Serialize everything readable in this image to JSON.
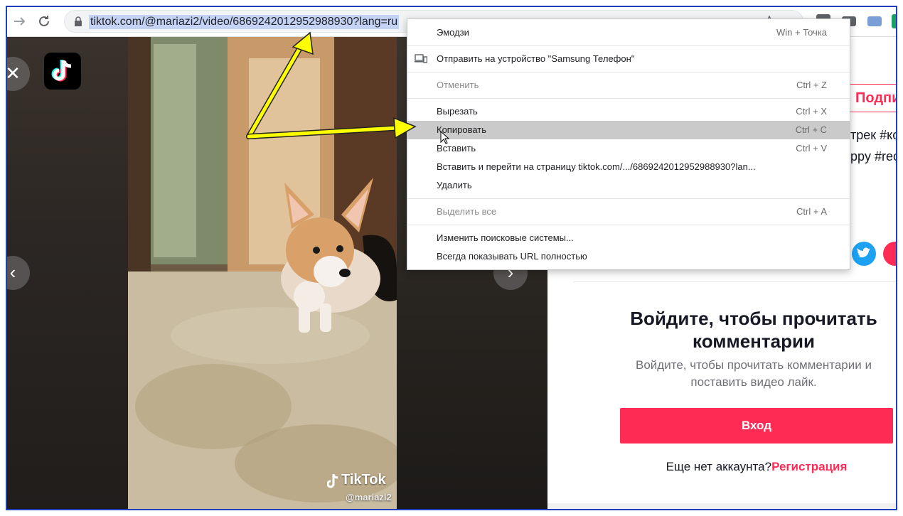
{
  "browser": {
    "url": "tiktok.com/@mariazi2/video/6869242012952988930?lang=ru",
    "back_icon": "arrow-right-icon",
    "reload_icon": "reload-icon"
  },
  "video": {
    "watermark_brand": "TikTok",
    "watermark_user": "@mariazi2",
    "close_icon": "close-icon",
    "prev_icon": "chevron-left-icon",
    "next_icon": "chevron-right-icon"
  },
  "panel": {
    "follow_label": "Подписаться",
    "desc_line1": "трек #ко",
    "desc_line2": "ppy #rec",
    "login_title": "Войдите, чтобы прочитать комментарии",
    "login_subtitle": "Войдите, чтобы прочитать комментарии и поставить видео лайк.",
    "login_button": "Вход",
    "signup_prompt": "Еще нет аккаунта?",
    "signup_link": "Регистрация",
    "accent_color": "#fe2c55"
  },
  "context_menu": {
    "items": [
      {
        "label": "Эмодзи",
        "shortcut": "Win + Точка"
      },
      {
        "label": "Отправить на устройство \"Samsung Телефон\"",
        "shortcut": ""
      },
      {
        "label": "Отменить",
        "shortcut": "Ctrl + Z"
      },
      {
        "label": "Вырезать",
        "shortcut": "Ctrl + X"
      },
      {
        "label": "Копировать",
        "shortcut": "Ctrl + C"
      },
      {
        "label": "Вставить",
        "shortcut": "Ctrl + V"
      },
      {
        "label": "Вставить и перейти на страницу tiktok.com/.../6869242012952988930?lan...",
        "shortcut": ""
      },
      {
        "label": "Удалить",
        "shortcut": ""
      },
      {
        "label": "Выделить все",
        "shortcut": "Ctrl + A"
      },
      {
        "label": "Изменить поисковые системы...",
        "shortcut": ""
      },
      {
        "label": "Всегда показывать URL полностью",
        "shortcut": ""
      }
    ],
    "highlighted": "Копировать"
  },
  "annotation": {
    "arrow_color": "#ffff00"
  }
}
